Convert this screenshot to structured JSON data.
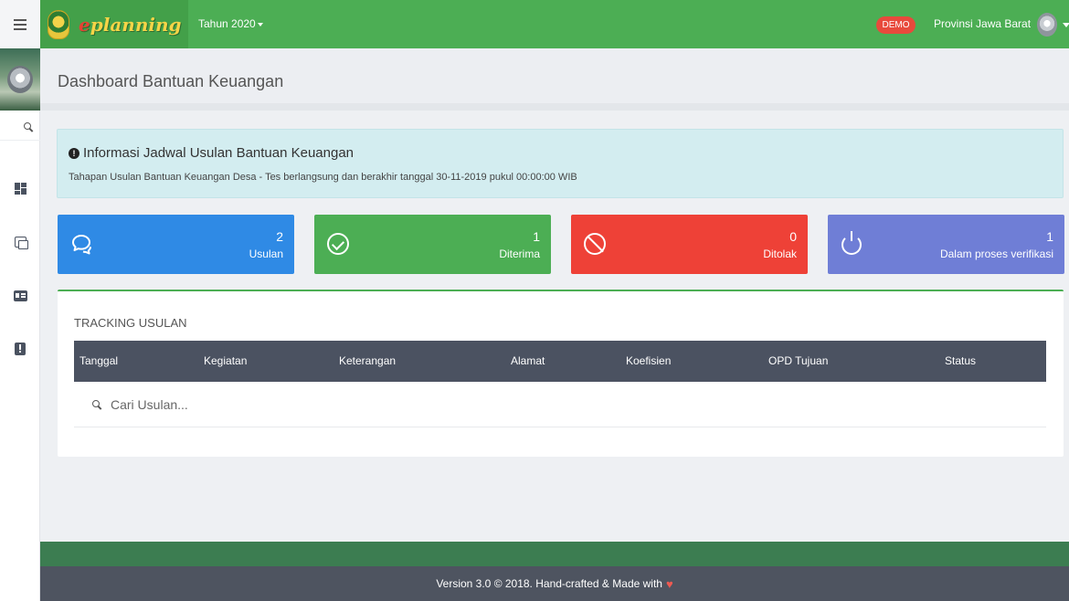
{
  "topbar": {
    "brand_prefix": "e",
    "brand_rest": "planning",
    "year_label": "Tahun 2020",
    "demo_badge": "DEMO",
    "province": "Provinsi Jawa Barat"
  },
  "sidebar": {
    "items": [
      {
        "name": "dashboard",
        "icon": "dashboard-icon"
      },
      {
        "name": "messages",
        "icon": "chat-icon"
      },
      {
        "name": "profile",
        "icon": "id-card-icon"
      },
      {
        "name": "report",
        "icon": "alert-icon"
      }
    ]
  },
  "page": {
    "title": "Dashboard Bantuan Keuangan"
  },
  "info": {
    "title": "Informasi Jadwal Usulan Bantuan Keuangan",
    "text": "Tahapan Usulan Bantuan Keuangan Desa - Tes berlangsung dan berakhir tanggal 30-11-2019 pukul 00:00:00 WIB"
  },
  "stats": [
    {
      "value": "2",
      "label": "Usulan",
      "color": "#2f8ae5",
      "icon": "chat-icon"
    },
    {
      "value": "1",
      "label": "Diterima",
      "color": "#4cae54",
      "icon": "check-circle-icon"
    },
    {
      "value": "0",
      "label": "Ditolak",
      "color": "#ee4137",
      "icon": "ban-icon"
    },
    {
      "value": "1",
      "label": "Dalam proses verifikasi",
      "color": "#6f7ed6",
      "icon": "power-icon"
    }
  ],
  "tracking": {
    "title": "TRACKING USULAN",
    "columns": [
      "Tanggal",
      "Kegiatan",
      "Keterangan",
      "Alamat",
      "Koefisien",
      "OPD Tujuan",
      "Status"
    ],
    "search_placeholder": "Cari Usulan..."
  },
  "footer": {
    "text": "Version 3.0 © 2018. Hand-crafted & Made with",
    "heart": "♥"
  }
}
